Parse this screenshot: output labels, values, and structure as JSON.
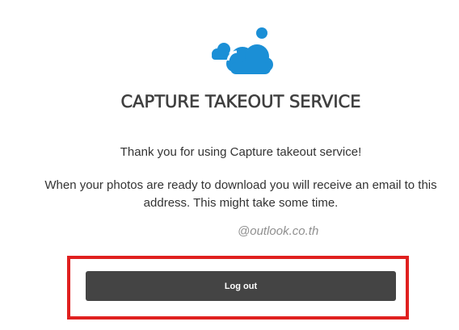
{
  "brand": {
    "logo_icon": "cloud-icon",
    "accent_color": "#1b8fd6"
  },
  "header": {
    "title": "CAPTURE TAKEOUT SERVICE"
  },
  "main": {
    "thanks_text": "Thank you for using Capture takeout service!",
    "info_text": "When your photos are ready to download you will receive an email to this address. This might take some time.",
    "email": "@outlook.co.th"
  },
  "actions": {
    "logout_label": "Log out",
    "highlight_color": "#e0201f"
  }
}
